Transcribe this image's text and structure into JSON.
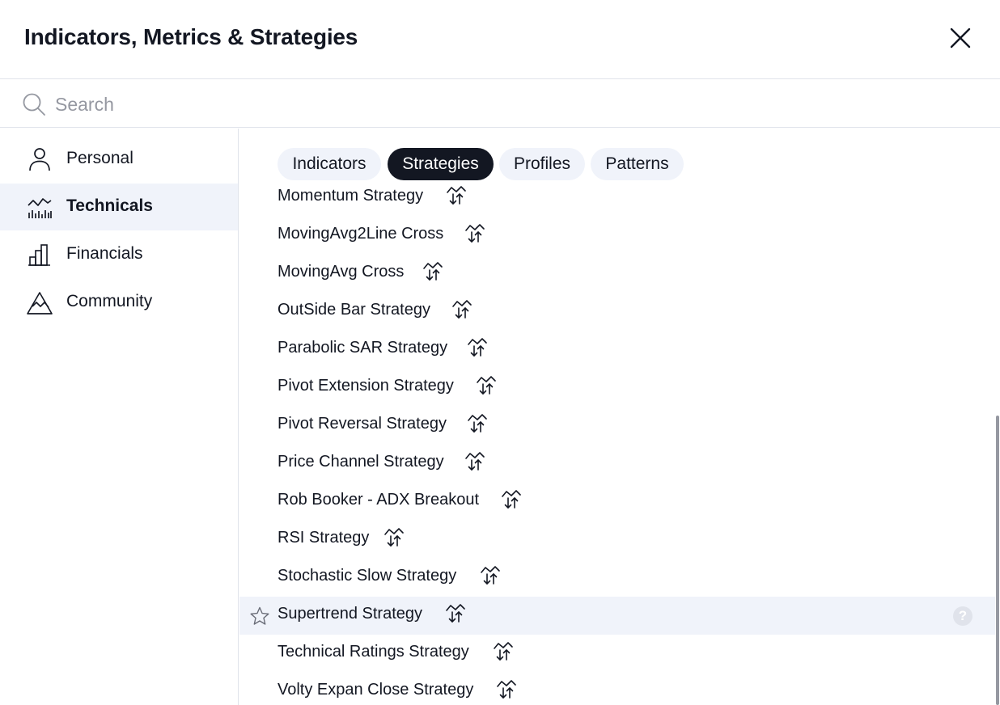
{
  "dialog": {
    "title": "Indicators, Metrics & Strategies",
    "close_icon": "close-icon"
  },
  "search": {
    "placeholder": "Search",
    "value": "",
    "icon": "search-icon"
  },
  "sidebar": {
    "items": [
      {
        "label": "Personal",
        "icon": "person-icon",
        "active": false
      },
      {
        "label": "Technicals",
        "icon": "technicals-chart-icon",
        "active": true
      },
      {
        "label": "Financials",
        "icon": "bar-chart-icon",
        "active": false
      },
      {
        "label": "Community",
        "icon": "community-icon",
        "active": false
      }
    ]
  },
  "tabs": [
    {
      "label": "Indicators",
      "active": false
    },
    {
      "label": "Strategies",
      "active": true
    },
    {
      "label": "Profiles",
      "active": false
    },
    {
      "label": "Patterns",
      "active": false
    }
  ],
  "strategies": [
    {
      "name": "Momentum Strategy"
    },
    {
      "name": "MovingAvg2Line Cross"
    },
    {
      "name": "MovingAvg Cross"
    },
    {
      "name": "OutSide Bar Strategy"
    },
    {
      "name": "Parabolic SAR Strategy"
    },
    {
      "name": "Pivot Extension Strategy"
    },
    {
      "name": "Pivot Reversal Strategy"
    },
    {
      "name": "Price Channel Strategy"
    },
    {
      "name": "Rob Booker - ADX Breakout"
    },
    {
      "name": "RSI Strategy"
    },
    {
      "name": "Stochastic Slow Strategy"
    },
    {
      "name": "Supertrend Strategy",
      "hovered": true
    },
    {
      "name": "Technical Ratings Strategy"
    },
    {
      "name": "Volty Expan Close Strategy"
    }
  ],
  "row_icons": {
    "strategy": "strategy-icon",
    "favorite": "star-icon",
    "help": "help-icon",
    "help_glyph": "?"
  },
  "colors": {
    "text": "#131722",
    "placeholder": "#9598a1",
    "active_tab_bg": "#131722",
    "tab_bg": "#f0f3fa",
    "hover_bg": "#f0f3fa",
    "divider": "#e0e3eb"
  }
}
